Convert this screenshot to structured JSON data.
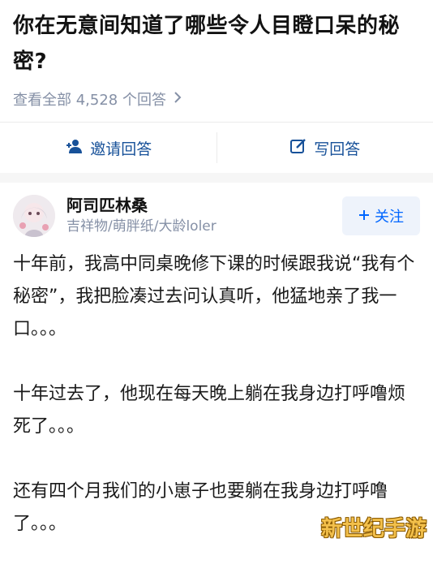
{
  "question": {
    "title": "你在无意间知道了哪些令人目瞪口呆的秘密?",
    "view_all_label": "查看全部 4,528 个回答"
  },
  "actions": {
    "invite_label": "邀请回答",
    "write_label": "写回答"
  },
  "author": {
    "name": "阿司匹林桑",
    "bio": "吉祥物/萌胖纸/大龄loler",
    "follow_label": "关注"
  },
  "answer": {
    "paragraphs": [
      "十年前，我高中同桌晚修下课的时候跟我说“我有个秘密”，我把脸凑过去问认真听，他猛地亲了我一口。。。",
      "十年过去了，他现在每天晚上躺在我身边打呼噜烦死了。。。",
      "还有四个月我们的小崽子也要躺在我身边打呼噜了。。。"
    ]
  },
  "watermark": "新世纪手游",
  "colors": {
    "link_blue": "#175199",
    "follow_blue": "#0066ff",
    "muted_gray": "#8590a6"
  }
}
